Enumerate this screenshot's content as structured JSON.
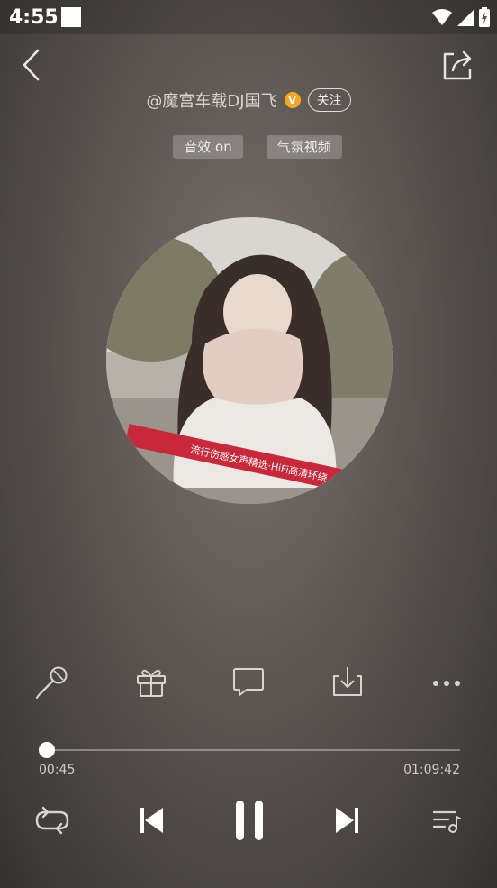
{
  "status_bar": {
    "time": "4:55"
  },
  "header": {
    "artist": "@魔宫车载DJ国飞",
    "vip_badge": "V",
    "follow_label": "关注"
  },
  "tags": [
    {
      "label": "音效 on"
    },
    {
      "label": "气氛视频"
    }
  ],
  "cover": {
    "banner_text": "流行伤感女声精选·HiFi高清环绕"
  },
  "playback": {
    "elapsed": "00:45",
    "duration": "01:09:42",
    "progress_fraction": 0.0108
  },
  "icons": {
    "back": "back-arrow-icon",
    "share": "share-icon",
    "karaoke": "microphone-icon",
    "gift": "gift-icon",
    "comment": "comment-icon",
    "download": "download-icon",
    "more": "more-icon",
    "repeat": "repeat-icon",
    "previous": "previous-icon",
    "pause": "pause-icon",
    "next": "next-icon",
    "playlist": "playlist-icon"
  },
  "colors": {
    "vip": "#f5a623",
    "banner": "#c8283a"
  }
}
